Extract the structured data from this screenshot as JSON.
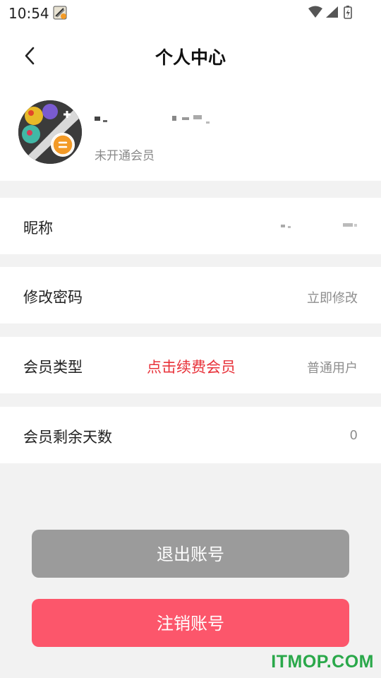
{
  "status_bar": {
    "time": "10:54",
    "icons": [
      "app-notification-icon",
      "wifi-icon",
      "signal-icon",
      "battery-charging-icon"
    ]
  },
  "header": {
    "title": "个人中心",
    "back_icon": "chevron-left-icon"
  },
  "profile": {
    "avatar_icon": "avatar",
    "badge_icon": "equals-badge-icon",
    "member_status": "未开通会员"
  },
  "rows": [
    {
      "label": "昵称",
      "value": ""
    },
    {
      "label": "修改密码",
      "value": "立即修改"
    },
    {
      "label": "会员类型",
      "action": "点击续费会员",
      "value": "普通用户"
    },
    {
      "label": "会员剩余天数",
      "value": "0"
    }
  ],
  "buttons": {
    "logout": "退出账号",
    "cancel_account": "注销账号"
  },
  "watermark": "ITMOP.COM",
  "colors": {
    "background": "#f2f2f2",
    "action_red": "#e8323a",
    "logout_gray": "#9b9b9b",
    "cancel_pink": "#fc566b",
    "badge_orange": "#f39a26",
    "watermark_green": "#2aa84a"
  }
}
